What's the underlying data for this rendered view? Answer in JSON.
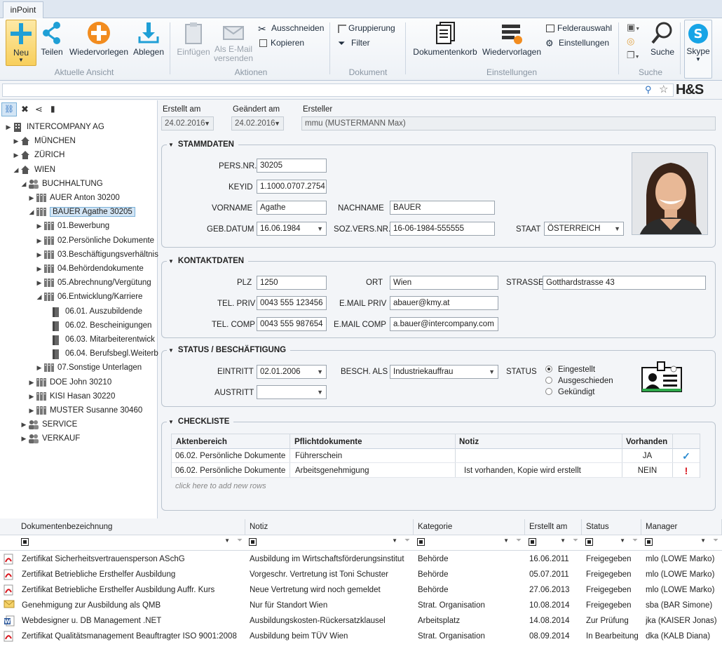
{
  "app": {
    "tab": "inPoint",
    "logo": "H&S"
  },
  "ribbon": {
    "groups": {
      "aktuelle_ansicht": "Aktuelle Ansicht",
      "aktionen": "Aktionen",
      "dokument": "Dokument",
      "einstellungen": "Einstellungen",
      "suche": "Suche"
    },
    "neu": "Neu",
    "teilen": "Teilen",
    "wiedervorlegen": "Wiedervorlegen",
    "ablegen": "Ablegen",
    "einfuegen": "Einfügen",
    "email_line1": "Als E-Mail",
    "email_line2": "versenden",
    "ausschneiden": "Ausschneiden",
    "kopieren": "Kopieren",
    "gruppierung": "Gruppierung",
    "filter": "Filter",
    "dokumentenkorb": "Dokumentenkorb",
    "wiedervorlagen": "Wiedervorlagen",
    "felderauswahl": "Felderauswahl",
    "einstellungen": "Einstellungen",
    "suche": "Suche",
    "skype": "Skype"
  },
  "search": {
    "value": ""
  },
  "tree": [
    {
      "label": "INTERCOMPANY AG",
      "level": 0,
      "arrow": "▶",
      "icon": "building-icon"
    },
    {
      "label": "MÜNCHEN",
      "level": 1,
      "arrow": "▶",
      "icon": "home-icon"
    },
    {
      "label": "ZÜRICH",
      "level": 1,
      "arrow": "▶",
      "icon": "home-icon"
    },
    {
      "label": "WIEN",
      "level": 1,
      "arrow": "◢",
      "icon": "home-icon"
    },
    {
      "label": "BUCHHALTUNG",
      "level": 2,
      "arrow": "◢",
      "icon": "people-icon"
    },
    {
      "label": "AUER Anton 30200",
      "level": 3,
      "arrow": "▶",
      "icon": "cabinet-icon"
    },
    {
      "label": "BAUER Agathe 30205",
      "level": 3,
      "arrow": "◢",
      "icon": "cabinet-icon",
      "selected": true
    },
    {
      "label": "01.Bewerbung",
      "level": 4,
      "arrow": "▶",
      "icon": "cabinet-icon"
    },
    {
      "label": "02.Persönliche Dokumente",
      "level": 4,
      "arrow": "▶",
      "icon": "cabinet-icon"
    },
    {
      "label": "03.Beschäftigungsverhältnis",
      "level": 4,
      "arrow": "▶",
      "icon": "cabinet-icon"
    },
    {
      "label": "04.Behördendokumente",
      "level": 4,
      "arrow": "▶",
      "icon": "cabinet-icon"
    },
    {
      "label": "05.Abrechnung/Vergütung",
      "level": 4,
      "arrow": "▶",
      "icon": "cabinet-icon"
    },
    {
      "label": "06.Entwicklung/Karriere",
      "level": 4,
      "arrow": "◢",
      "icon": "cabinet-icon"
    },
    {
      "label": "06.01. Auszubildende",
      "level": 5,
      "arrow": "",
      "icon": "binder-icon"
    },
    {
      "label": "06.02. Bescheinigungen",
      "level": 5,
      "arrow": "",
      "icon": "binder-icon"
    },
    {
      "label": "06.03. Mitarbeiterentwick",
      "level": 5,
      "arrow": "",
      "icon": "binder-icon"
    },
    {
      "label": "06.04. Berufsbegl.Weiterb",
      "level": 5,
      "arrow": "",
      "icon": "binder-icon"
    },
    {
      "label": "07.Sonstige Unterlagen",
      "level": 4,
      "arrow": "▶",
      "icon": "cabinet-icon"
    },
    {
      "label": "DOE John 30210",
      "level": 3,
      "arrow": "▶",
      "icon": "cabinet-icon"
    },
    {
      "label": "KISI Hasan 30220",
      "level": 3,
      "arrow": "▶",
      "icon": "cabinet-icon"
    },
    {
      "label": "MUSTER Susanne 30460",
      "level": 3,
      "arrow": "▶",
      "icon": "cabinet-icon"
    },
    {
      "label": "SERVICE",
      "level": 2,
      "arrow": "▶",
      "icon": "people-icon"
    },
    {
      "label": "VERKAUF",
      "level": 2,
      "arrow": "▶",
      "icon": "people-icon"
    }
  ],
  "meta": {
    "erstellt_label": "Erstellt am",
    "erstellt_value": "24.02.2016",
    "geaendert_label": "Geändert am",
    "geaendert_value": "24.02.2016",
    "ersteller_label": "Ersteller",
    "ersteller_value": "mmu (MUSTERMANN Max)"
  },
  "stammdaten": {
    "title": "STAMMDATEN",
    "persnr_label": "PERS.NR.",
    "persnr": "30205",
    "keyid_label": "KEYID",
    "keyid": "1.1000.0707.2754",
    "vorname_label": "VORNAME",
    "vorname": "Agathe",
    "nachname_label": "NACHNAME",
    "nachname": "BAUER",
    "gebdatum_label": "GEB.DATUM",
    "gebdatum": "16.06.1984",
    "sozvers_label": "SOZ.VERS.NR.",
    "sozvers": "16-06-1984-555555",
    "staat_label": "STAAT",
    "staat": "ÖSTERREICH"
  },
  "kontakt": {
    "title": "KONTAKTDATEN",
    "plz_label": "PLZ",
    "plz": "1250",
    "ort_label": "ORT",
    "ort": "Wien",
    "strasse_label": "STRASSE",
    "strasse": "Gotthardstrasse 43",
    "telpriv_label": "TEL. PRIV",
    "telpriv": "0043 555 123456",
    "emailpriv_label": "E.MAIL PRIV",
    "emailpriv": "abauer@kmy.at",
    "telcomp_label": "TEL. COMP",
    "telcomp": "0043 555 987654",
    "emailcomp_label": "E.MAIL COMP",
    "emailcomp": "a.bauer@intercompany.com"
  },
  "status": {
    "title": "STATUS / BESCHÄFTIGUNG",
    "eintritt_label": "EINTRITT",
    "eintritt": "02.01.2006",
    "austritt_label": "AUSTRITT",
    "austritt": "",
    "besch_label": "BESCH. ALS",
    "besch": "Industriekauffrau",
    "status_label": "STATUS",
    "options": [
      "Eingestellt",
      "Ausgeschieden",
      "Gekündigt"
    ],
    "selected": "Eingestellt"
  },
  "checkliste": {
    "title": "CHECKLISTE",
    "headers": [
      "Aktenbereich",
      "Pflichtdokumente",
      "Notiz",
      "Vorhanden"
    ],
    "rows": [
      {
        "bereich": "06.02. Persönliche Dokumente",
        "pflicht": "Führerschein",
        "notiz": "",
        "vorhanden": "JA",
        "mark": "✓",
        "mark_color": "#2a8bd0"
      },
      {
        "bereich": "06.02. Persönliche Dokumente",
        "pflicht": "Arbeitsgenehmigung",
        "notiz": "Ist vorhanden, Kopie wird erstellt",
        "vorhanden": "NEIN",
        "mark": "!",
        "mark_color": "#d8141c"
      }
    ],
    "add_row": "click here to add new rows"
  },
  "grid": {
    "headers": [
      "Dokumentenbezeichnung",
      "Notiz",
      "Kategorie",
      "Erstellt am",
      "Status",
      "Manager"
    ],
    "rows": [
      {
        "icon": "pdf-icon",
        "name": "Zertifikat Sicherheitsvertrauensperson ASchG",
        "notiz": "Ausbildung im Wirtschaftsförderungsinstitut",
        "kategorie": "Behörde",
        "datum": "16.06.2011",
        "status": "Freigegeben",
        "manager": "mlo (LOWE Marko)"
      },
      {
        "icon": "pdf-icon",
        "name": "Zertifikat Betriebliche Ersthelfer Ausbildung",
        "notiz": "Vorgeschr. Vertretung ist Toni Schuster",
        "kategorie": "Behörde",
        "datum": "05.07.2011",
        "status": "Freigegeben",
        "manager": "mlo (LOWE Marko)"
      },
      {
        "icon": "pdf-icon",
        "name": "Zertifikat Betriebliche Ersthelfer Ausbildung Auffr. Kurs",
        "notiz": "Neue Vertretung wird noch gemeldet",
        "kategorie": "Behörde",
        "datum": "27.06.2013",
        "status": "Freigegeben",
        "manager": "mlo (LOWE Marko)"
      },
      {
        "icon": "mail-icon",
        "name": "Genehmigung zur Ausbildung als QMB",
        "notiz": "Nur für Standort Wien",
        "kategorie": "Strat. Organisation",
        "datum": "10.08.2014",
        "status": "Freigegeben",
        "manager": "sba (BAR Simone)"
      },
      {
        "icon": "word-icon",
        "name": "Webdesigner u.  DB  Management .NET",
        "notiz": "Ausbildungskosten-Rückersatzklausel",
        "kategorie": "Arbeitsplatz",
        "datum": "14.08.2014",
        "status": "Zur Prüfung",
        "manager": "jka (KAISER Jonas)"
      },
      {
        "icon": "pdf-icon",
        "name": "Zertifikat Qualitätsmanagement Beauftragter ISO 9001:2008",
        "notiz": "Ausbildung beim TÜV Wien",
        "kategorie": "Strat. Organisation",
        "datum": "08.09.2014",
        "status": "In Bearbeitung",
        "manager": "dka (KALB Diana)"
      }
    ]
  }
}
